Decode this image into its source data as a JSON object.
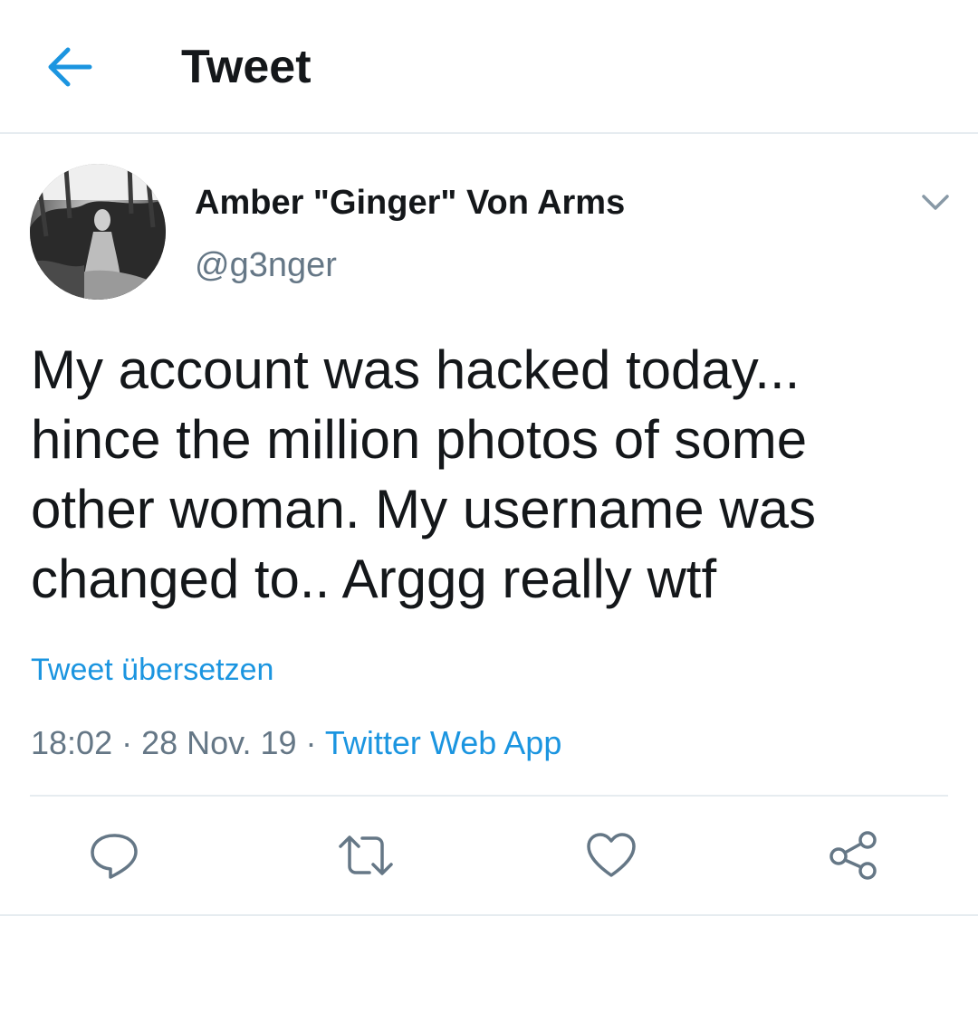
{
  "header": {
    "title": "Tweet",
    "back_icon": "arrow-left-icon"
  },
  "colors": {
    "accent": "#1b95e0",
    "text": "#14171a",
    "secondary": "#657786",
    "divider": "#e6ecf0"
  },
  "tweet": {
    "author_name": "Amber \"Ginger\" Von Arms",
    "author_handle": "@g3nger",
    "text": "My account was hacked today...\nhince the million photos of some\nother woman. My username was\nchanged to..  Arggg really wtf",
    "translate_label": "Tweet übersetzen",
    "time": "18:02",
    "separator": " · ",
    "date": "28 Nov. 19",
    "source": "Twitter Web App"
  },
  "actions": [
    {
      "icon": "reply-icon"
    },
    {
      "icon": "retweet-icon"
    },
    {
      "icon": "like-icon"
    },
    {
      "icon": "share-icon"
    }
  ]
}
